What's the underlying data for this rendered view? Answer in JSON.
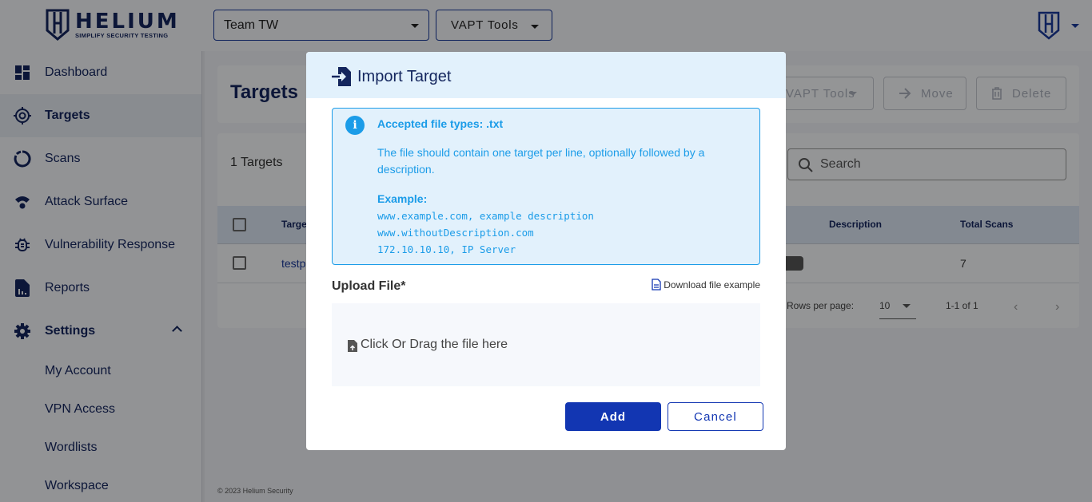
{
  "brand": {
    "name": "HELIUM",
    "tagline": "SIMPLIFY SECURITY TESTING",
    "primary_color": "#14265e",
    "accent_color": "#1236b2",
    "info_color": "#1b9ce8"
  },
  "topbar": {
    "team_select": {
      "value": "Team TW"
    },
    "tools_select": {
      "value": "VAPT Tools"
    },
    "user_menu_icon": "shield-h-icon"
  },
  "sidebar": {
    "items": [
      {
        "label": "Dashboard",
        "icon": "dashboard-icon"
      },
      {
        "label": "Targets",
        "icon": "target-icon",
        "active": true
      },
      {
        "label": "Scans",
        "icon": "scan-ring-icon"
      },
      {
        "label": "Attack Surface",
        "icon": "wifi-icon"
      },
      {
        "label": "Vulnerability Response",
        "icon": "bug-icon"
      },
      {
        "label": "Reports",
        "icon": "report-icon"
      },
      {
        "label": "Settings",
        "icon": "gear-icon",
        "expanded": true
      }
    ],
    "settings_sub": [
      "My Account",
      "VPN Access",
      "Wordlists",
      "Workspace"
    ]
  },
  "page": {
    "title": "Targets",
    "actions": {
      "tools": "VAPT Tools",
      "move": "Move",
      "delete": "Delete"
    },
    "count_label": "1 Targets",
    "search_placeholder": "Search",
    "table": {
      "columns": [
        "Target",
        "Description",
        "Total Scans"
      ],
      "rows": [
        {
          "target": "testp",
          "description": "",
          "total_scans": "7"
        }
      ]
    },
    "pagination": {
      "rows_per_page_label": "Rows per page:",
      "rows_per_page": "10",
      "range": "1-1 of 1"
    },
    "footer": "© 2023 Helium Security"
  },
  "modal": {
    "title": "Import Target",
    "info": {
      "title": "Accepted file types: .txt",
      "description": "The file should contain one target per line, optionally followed by a description.",
      "example_label": "Example:",
      "example_lines": [
        "www.example.com, example description",
        "www.withoutDescription.com",
        "172.10.10.10, IP Server"
      ]
    },
    "upload_label": "Upload File*",
    "download_link": "Download file example",
    "dropzone_text": "Click Or Drag the file here",
    "add_button": "Add",
    "cancel_button": "Cancel"
  }
}
